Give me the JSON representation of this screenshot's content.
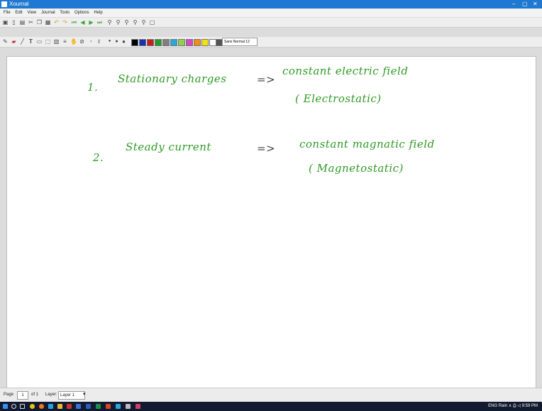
{
  "window": {
    "title": "Xournal",
    "controls": [
      "–",
      "▢",
      "✕"
    ]
  },
  "menu": [
    "File",
    "Edit",
    "View",
    "Journal",
    "Tools",
    "Options",
    "Help"
  ],
  "toolbar1": {
    "icons": [
      "save-icon",
      "new-icon",
      "open-icon",
      "cut-icon",
      "copy-icon",
      "paste-icon",
      "undo-icon",
      "redo-icon",
      "first-page-icon",
      "prev-page-icon",
      "next-page-icon",
      "last-page-icon",
      "zoom-icon",
      "zoom-in-icon",
      "zoom-out-icon",
      "zoom-fit-icon",
      "zoom-page-icon",
      "fullscreen-icon"
    ]
  },
  "toolbar2": {
    "icons": [
      "pen-icon",
      "eraser-icon",
      "highlighter-icon",
      "text-icon",
      "image-icon",
      "select-rect-icon",
      "select-region-icon",
      "vertical-space-icon",
      "hand-icon",
      "ruler-icon",
      "shape-icon",
      "default-pen-icon"
    ],
    "colors": [
      "#000000",
      "#1b2fb5",
      "#c81e1e",
      "#1f9d2d",
      "#7f7f7f",
      "#2aa7d6",
      "#8fd34a",
      "#d646c6",
      "#f18b1a",
      "#f2e40d",
      "#ffffff",
      "#555555"
    ],
    "pen_select": "Sans Normal 12"
  },
  "notes": {
    "line1": {
      "number": "1.",
      "text": "Stationary charges",
      "arrow": "=>",
      "result": "constant electric field",
      "note": "( Electrostatic)"
    },
    "line2": {
      "number": "2.",
      "text": "Steady current",
      "arrow": "=>",
      "result": "constant magnatic field",
      "note": "( Magnetostatic)"
    }
  },
  "status": {
    "page_label": "Page",
    "page_value": "1",
    "page_total": "of 1",
    "layer_label": "Layer:",
    "layer_value": "Layer 1"
  },
  "taskbar": {
    "apps": [
      "start-icon",
      "search-icon",
      "task-view-icon",
      "chrome-icon",
      "firefox-icon",
      "edge-icon",
      "files-icon",
      "mail-icon",
      "store-icon",
      "word-icon",
      "excel-icon",
      "powerpoint-icon",
      "xournal-icon",
      "settings-icon",
      "media-icon"
    ],
    "tray_text": "ENG Rain  ∧  ⎙ ◁ 9:59 PM"
  }
}
